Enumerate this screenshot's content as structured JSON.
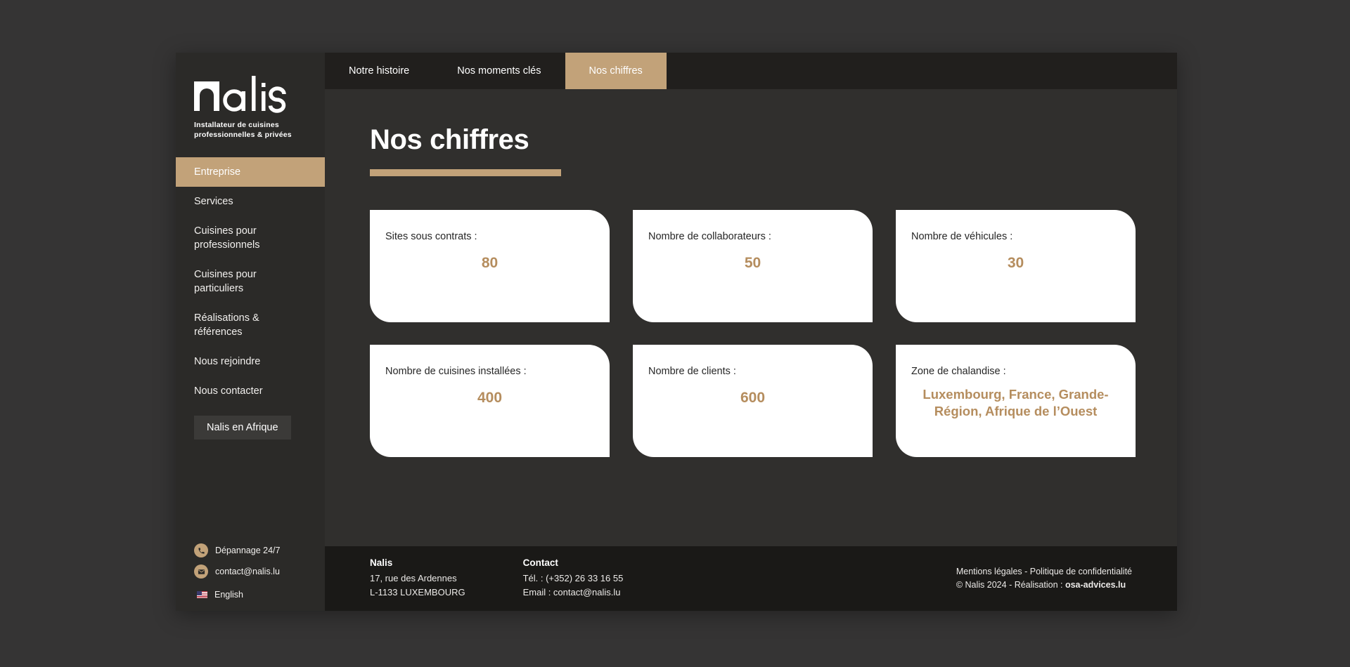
{
  "brand": {
    "logo_text": "nalis",
    "tagline": "Installateur de cuisines\nprofessionnelles & privées"
  },
  "sidebar": {
    "items": [
      {
        "label": "Entreprise",
        "active": true
      },
      {
        "label": "Services",
        "active": false
      },
      {
        "label": "Cuisines pour professionnels",
        "active": false
      },
      {
        "label": "Cuisines pour particuliers",
        "active": false
      },
      {
        "label": "Réalisations & références",
        "active": false
      },
      {
        "label": "Nous rejoindre",
        "active": false
      },
      {
        "label": "Nous contacter",
        "active": false
      }
    ],
    "africa_button": "Nalis en Afrique",
    "contacts": [
      {
        "icon": "phone-icon",
        "text": "Dépannage 24/7"
      },
      {
        "icon": "envelope-icon",
        "text": "contact@nalis.lu"
      }
    ],
    "language": {
      "flag": "us-flag-icon",
      "label": "English"
    }
  },
  "tabs": [
    {
      "label": "Notre histoire",
      "active": false
    },
    {
      "label": "Nos moments clés",
      "active": false
    },
    {
      "label": "Nos chiffres",
      "active": true
    }
  ],
  "main": {
    "title": "Nos chiffres"
  },
  "stats": [
    {
      "label": "Sites sous contrats :",
      "value": "80"
    },
    {
      "label": "Nombre de collaborateurs :",
      "value": "50"
    },
    {
      "label": "Nombre de véhicules :",
      "value": "30"
    },
    {
      "label": "Nombre de cuisines installées :",
      "value": "400"
    },
    {
      "label": "Nombre de clients :",
      "value": "600"
    },
    {
      "label": "Zone de chalandise :",
      "value": "Luxembourg, France, Grande-Région, Afrique de l’Ouest"
    }
  ],
  "footer": {
    "company": {
      "heading": "Nalis",
      "line1": "17, rue des Ardennes",
      "line2": "L-1133 LUXEMBOURG"
    },
    "contact": {
      "heading": "Contact",
      "line1": "Tél. : (+352) 26 33 16 55",
      "line2": "Email : contact@nalis.lu"
    },
    "legal": {
      "links": "Mentions légales - Politique de confidentialité",
      "copyright_prefix": "© Nalis 2024 - Réalisation : ",
      "credit": "osa-advices.lu"
    }
  },
  "colors": {
    "accent": "#c2a279",
    "value_text": "#b58d5e",
    "sidebar_bg": "#2b2a28",
    "content_bg": "#302f2d",
    "tabbar_bg": "#211f1d",
    "footer_bg": "#1a1917",
    "page_bg": "#353434",
    "card_bg": "#ffffff"
  }
}
